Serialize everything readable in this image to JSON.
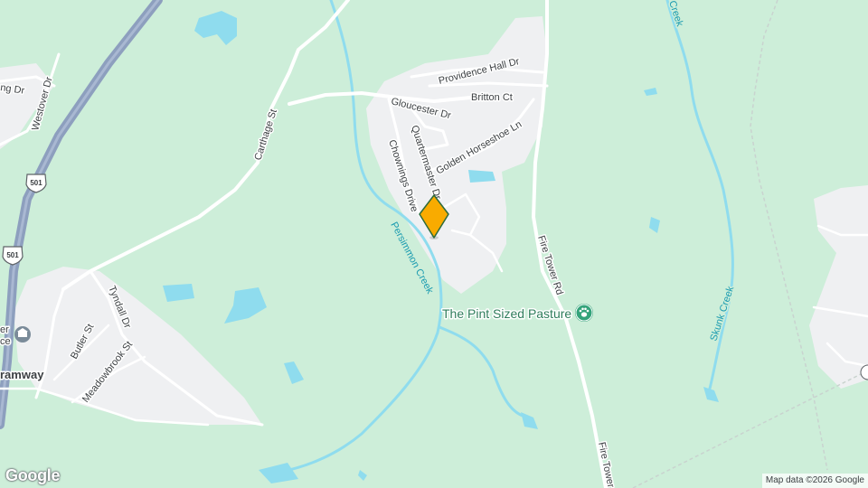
{
  "map": {
    "streets": {
      "providence_hall": "Providence Hall Dr",
      "britton": "Britton Ct",
      "gloucester": "Gloucester Dr",
      "quartermaster": "Quartermaster Dr",
      "golden_horseshoe": "Golden Horseshoe Ln",
      "chownings": "Chownings Drive",
      "carthage": "Carthage St",
      "westover": "Westover Dr",
      "fire_tower_1": "Fire Tower Rd",
      "fire_tower_2": "Fire Tower",
      "tyndall": "Tyndall Dr",
      "butler": "Butler St",
      "meadowbrook": "Meadowbrook St",
      "partial_ng": "ng Dr",
      "tramway": "ramway",
      "partial_er": "er",
      "partial_ce": "ce"
    },
    "waterways": {
      "persimmon_creek": "Persimmon Creek",
      "skunk_creek_1": "Skunk Creek",
      "skunk_creek_2": "Creek"
    },
    "highway_shields": [
      "501",
      "501"
    ],
    "poi": {
      "name": "The Pint Sized Pasture",
      "icon": "paw-icon",
      "color": "#34a37a"
    },
    "marker": {
      "icon": "location-pin-icon",
      "color": "#f9ab00"
    }
  },
  "branding": {
    "logo": "Google",
    "attribution": "Map data ©2026 Google"
  },
  "colors": {
    "land": "#cdeed9",
    "water": "#8fdcee",
    "road": "#ffffff",
    "highway": "#8d9fbe",
    "residential": "#eff0f2"
  }
}
